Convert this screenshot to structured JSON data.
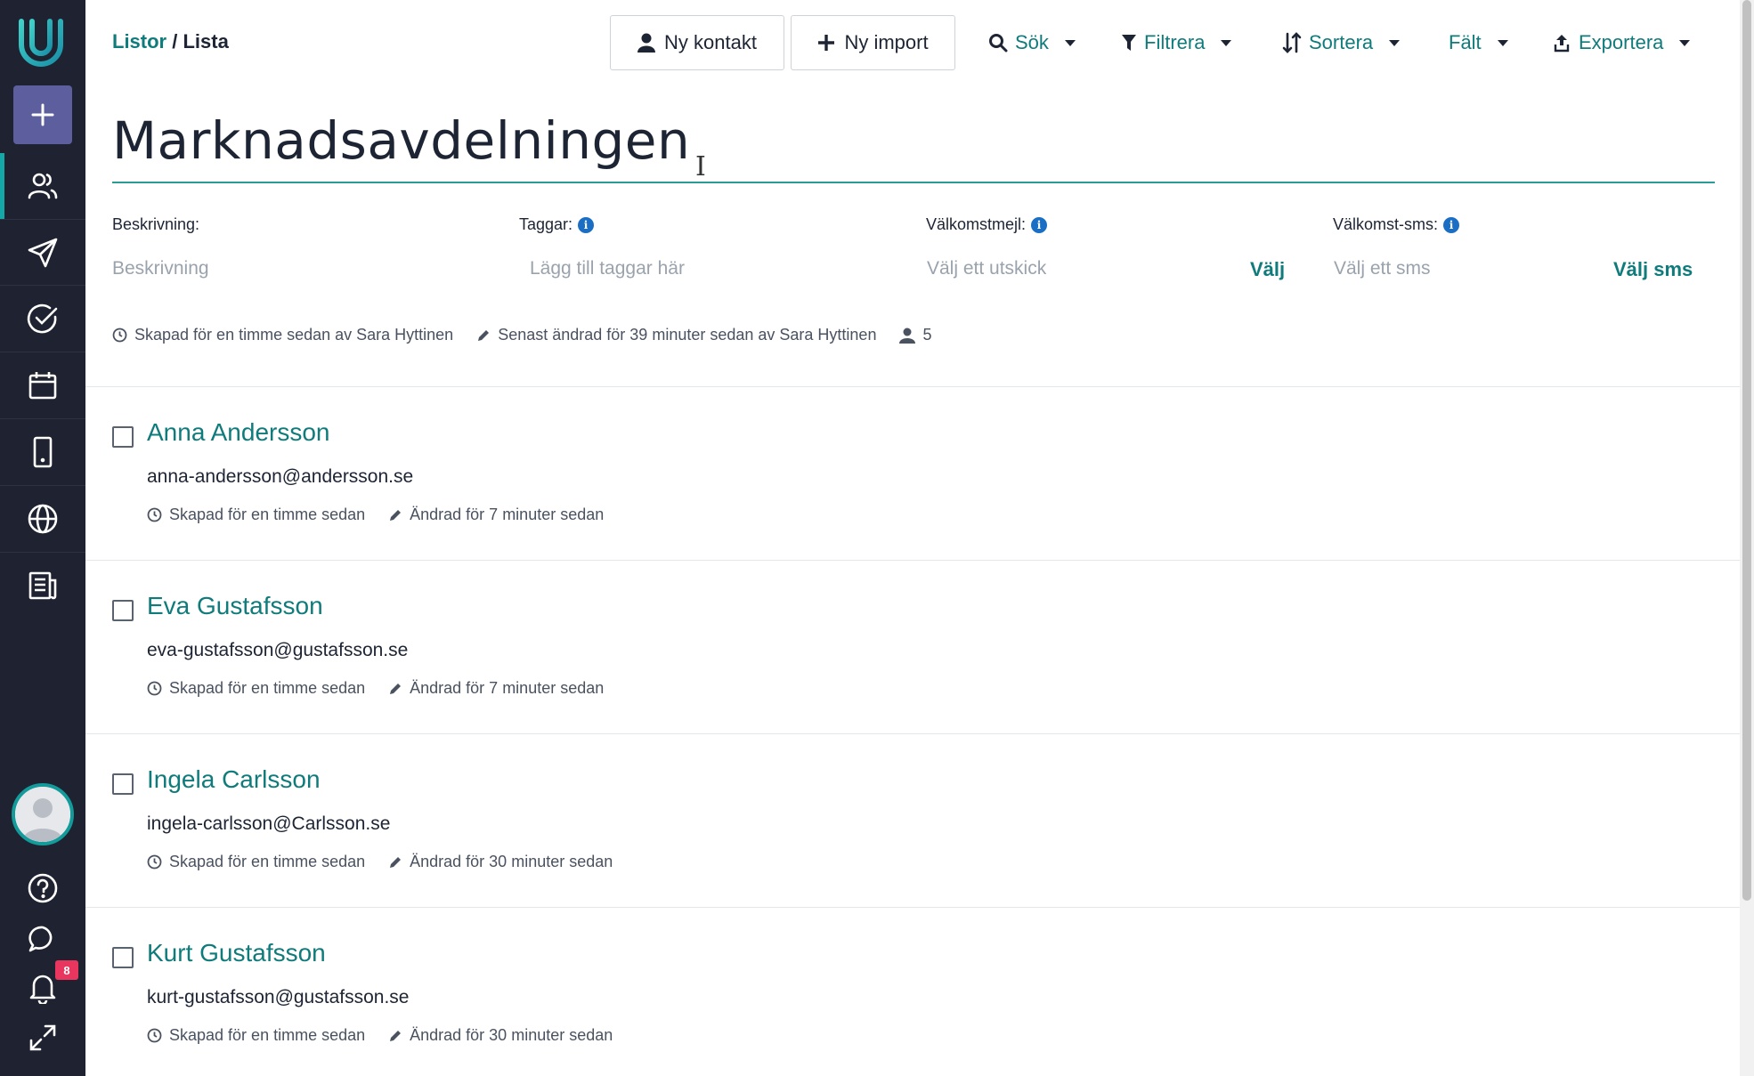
{
  "breadcrumb": {
    "parent": "Listor",
    "separator": " / ",
    "current": "Lista"
  },
  "toolbar": {
    "new_contact": "Ny kontakt",
    "new_import": "Ny import",
    "search": "Sök",
    "filter": "Filtrera",
    "sort": "Sortera",
    "fields": "Fält",
    "export": "Exportera"
  },
  "page": {
    "title": "Marknadsavdelningen"
  },
  "fields": {
    "description": {
      "label": "Beskrivning:",
      "placeholder": "Beskrivning"
    },
    "tags": {
      "label": "Taggar:",
      "placeholder": "Lägg till taggar här"
    },
    "welcome_mail": {
      "label": "Välkomstmejl:",
      "placeholder": "Välj ett utskick",
      "action": "Välj"
    },
    "welcome_sms": {
      "label": "Välkomst-sms:",
      "placeholder": "Välj ett sms",
      "action": "Välj sms"
    }
  },
  "meta": {
    "created": "Skapad för en timme sedan av Sara Hyttinen",
    "modified": "Senast ändrad för 39 minuter sedan av Sara Hyttinen",
    "count": "5"
  },
  "contacts": [
    {
      "name": "Anna Andersson",
      "email": "anna-andersson@andersson.se",
      "created": "Skapad för en timme sedan",
      "modified": "Ändrad för 7 minuter sedan"
    },
    {
      "name": "Eva Gustafsson",
      "email": "eva-gustafsson@gustafsson.se",
      "created": "Skapad för en timme sedan",
      "modified": "Ändrad för 7 minuter sedan"
    },
    {
      "name": "Ingela Carlsson",
      "email": "ingela-carlsson@Carlsson.se",
      "created": "Skapad för en timme sedan",
      "modified": "Ändrad för 30 minuter sedan"
    },
    {
      "name": "Kurt Gustafsson",
      "email": "kurt-gustafsson@gustafsson.se",
      "created": "Skapad för en timme sedan",
      "modified": "Ändrad för 30 minuter sedan"
    }
  ],
  "notifications": {
    "count": "8"
  },
  "colors": {
    "accent": "#0f7b7b",
    "sidebar": "#1f2331",
    "badge": "#e8365f"
  }
}
